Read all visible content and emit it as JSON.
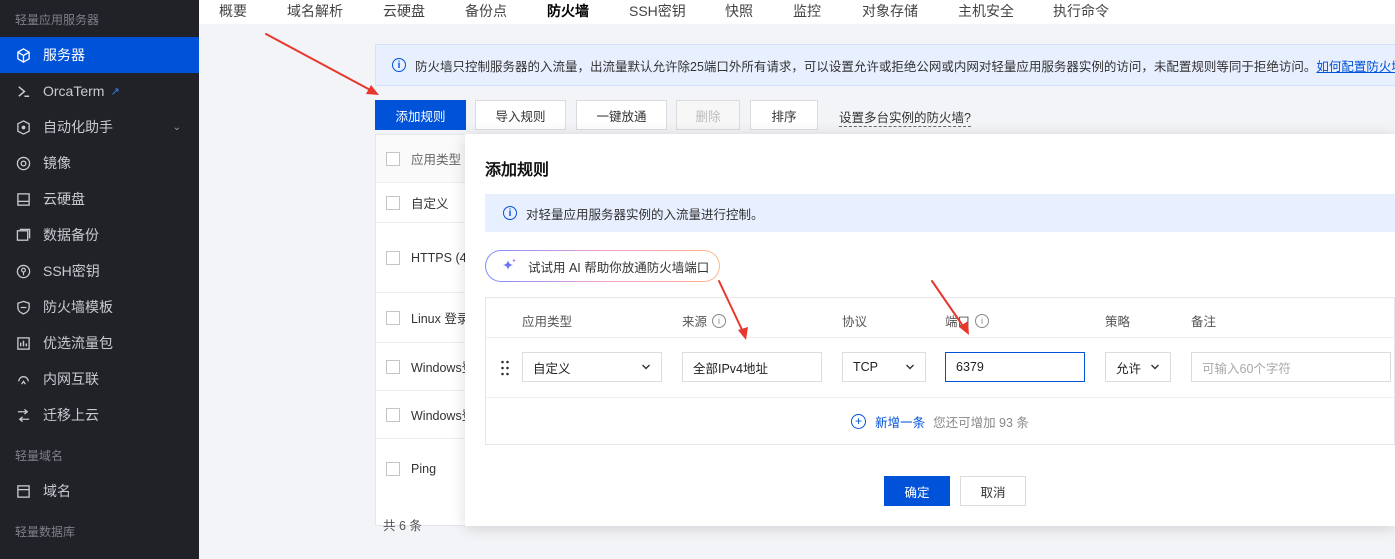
{
  "sidebar": {
    "group_servers": "轻量应用服务器",
    "items": [
      {
        "label": "服务器",
        "icon": "cube-icon",
        "active": true
      },
      {
        "label": "OrcaTerm",
        "icon": "terminal-icon",
        "external": true
      },
      {
        "label": "自动化助手",
        "icon": "automation-icon",
        "expandable": true
      },
      {
        "label": "镜像",
        "icon": "image-icon"
      },
      {
        "label": "云硬盘",
        "icon": "disk-icon"
      },
      {
        "label": "数据备份",
        "icon": "backup-icon"
      },
      {
        "label": "SSH密钥",
        "icon": "key-icon"
      },
      {
        "label": "防火墙模板",
        "icon": "shield-icon"
      },
      {
        "label": "优选流量包",
        "icon": "traffic-icon"
      },
      {
        "label": "内网互联",
        "icon": "network-icon"
      },
      {
        "label": "迁移上云",
        "icon": "migrate-icon"
      }
    ],
    "group_domain": "轻量域名",
    "domain_item": {
      "label": "域名",
      "icon": "domain-icon"
    },
    "group_db": "轻量数据库"
  },
  "tabs": [
    {
      "label": "概要"
    },
    {
      "label": "域名解析"
    },
    {
      "label": "云硬盘"
    },
    {
      "label": "备份点"
    },
    {
      "label": "防火墙",
      "active": true
    },
    {
      "label": "SSH密钥"
    },
    {
      "label": "快照"
    },
    {
      "label": "监控"
    },
    {
      "label": "对象存储"
    },
    {
      "label": "主机安全"
    },
    {
      "label": "执行命令"
    }
  ],
  "notice": {
    "text": "防火墙只控制服务器的入流量，出流量默认允许除25端口外所有请求，可以设置允许或拒绝公网或内网对轻量应用服务器实例的访问，未配置规则等同于拒绝访问。",
    "link": "如何配置防火墙规则"
  },
  "toolbar": {
    "add": "添加规则",
    "import": "导入规则",
    "open_all": "一键放通",
    "delete": "删除",
    "sort": "排序",
    "multi": "设置多台实例的防火墙?"
  },
  "table": {
    "header": "应用类型",
    "rows": [
      "自定义",
      "HTTPS (4",
      "Linux 登录",
      "Windows登",
      "Windows登",
      "Ping"
    ],
    "total": "共 6 条"
  },
  "modal": {
    "title": "添加规则",
    "notice": "对轻量应用服务器实例的入流量进行控制。",
    "ai_button": "试试用 AI 帮助你放通防火墙端口",
    "columns": {
      "app_type": "应用类型",
      "source": "来源",
      "protocol": "协议",
      "port": "端口",
      "policy": "策略",
      "remark": "备注"
    },
    "row": {
      "app_type": "自定义",
      "source": "全部IPv4地址",
      "protocol": "TCP",
      "port": "6379",
      "policy": "允许",
      "remark_placeholder": "可输入60个字符"
    },
    "add_link": "新增一条",
    "add_hint": "您还可增加 93 条",
    "ok": "确定",
    "cancel": "取消"
  },
  "colors": {
    "primary": "#0052d9",
    "annotation_arrow": "#e8372c",
    "sidebar_bg": "#202228"
  }
}
